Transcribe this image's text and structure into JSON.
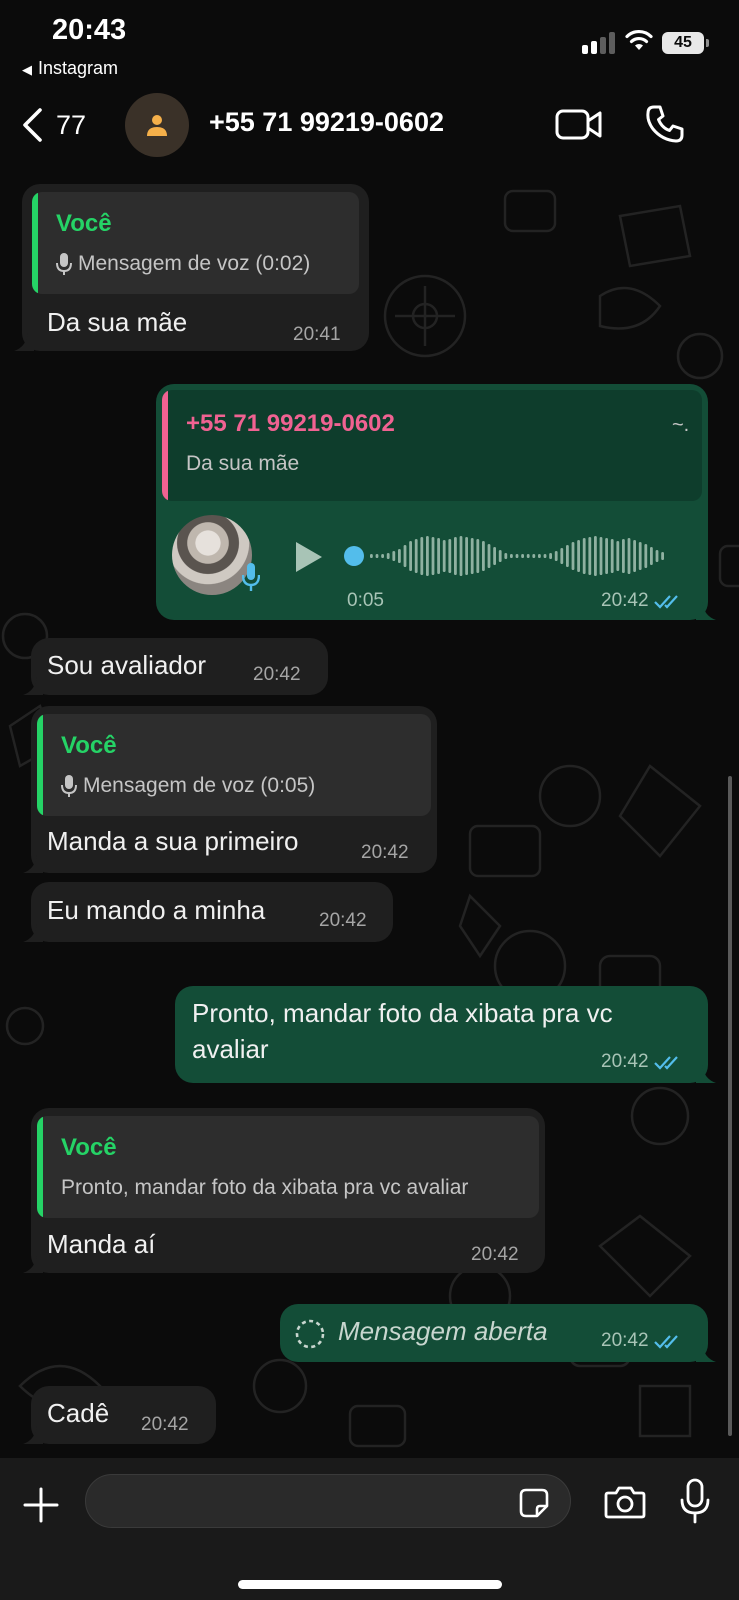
{
  "status_bar": {
    "time": "20:43",
    "back_app": "Instagram",
    "battery": "45"
  },
  "header": {
    "back_count": "77",
    "contact": "+55 71 99219-0602",
    "icons": [
      "chevron-left-icon",
      "person-icon",
      "video-camera-icon",
      "phone-icon"
    ]
  },
  "messages": [
    {
      "direction": "in",
      "quote": {
        "author": "Você",
        "text": "Mensagem de voz (0:02)",
        "icon": "mic-icon"
      },
      "text": "Da sua mãe",
      "time": "20:41"
    },
    {
      "direction": "out",
      "quote": {
        "author": "+55 71 99219-0602",
        "text": "Da sua mãe",
        "extra": "~."
      },
      "voice": {
        "duration": "0:05",
        "progress": 0
      },
      "time": "20:42",
      "status": "read"
    },
    {
      "direction": "in",
      "text": "Sou avaliador",
      "time": "20:42"
    },
    {
      "direction": "in",
      "quote": {
        "author": "Você",
        "text": "Mensagem de voz (0:05)",
        "icon": "mic-icon"
      },
      "text": "Manda a sua primeiro",
      "time": "20:42"
    },
    {
      "direction": "in",
      "text": "Eu mando a minha",
      "time": "20:42"
    },
    {
      "direction": "out",
      "text_lines": [
        "Pronto, mandar foto da xibata pra vc",
        "avaliar"
      ],
      "time": "20:42",
      "status": "read"
    },
    {
      "direction": "in",
      "quote": {
        "author": "Você",
        "text": "Pronto, mandar foto da xibata pra vc avaliar"
      },
      "text": "Manda aí",
      "time": "20:42"
    },
    {
      "direction": "out",
      "text": "Mensagem aberta",
      "view_once": true,
      "time": "20:42",
      "status": "read"
    },
    {
      "direction": "in",
      "text": "Cadê",
      "time": "20:42"
    }
  ],
  "input": {
    "placeholder": "",
    "icons": [
      "plus-icon",
      "sticker-icon",
      "camera-icon",
      "microphone-icon"
    ]
  },
  "colors": {
    "background": "#0b0b0b",
    "incoming_bubble": "#1f1f1f",
    "outgoing_bubble": "#134d37",
    "you_author": "#25d366",
    "contact_author": "#f06292",
    "read_ticks": "#53bdeb"
  }
}
